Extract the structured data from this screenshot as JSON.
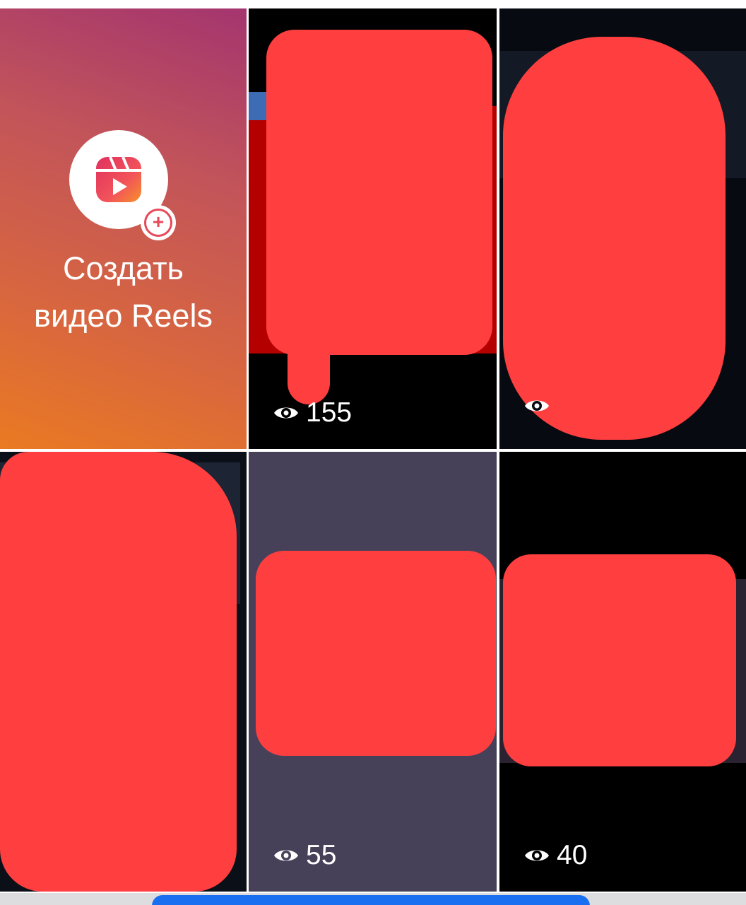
{
  "create_tile": {
    "label_line1": "Создать",
    "label_line2": "видео Reels",
    "icon": "reels-icon",
    "badge_icon": "plus-icon",
    "gradient_colors": [
      "#a4356f",
      "#c2545a",
      "#d8663f",
      "#ea7a22"
    ]
  },
  "reels": [
    {
      "views": "155",
      "icon": "eye-icon"
    },
    {
      "views": "",
      "icon": "eye-icon"
    },
    {
      "views": "",
      "icon": "eye-icon"
    },
    {
      "views": "55",
      "icon": "eye-icon"
    },
    {
      "views": "40",
      "icon": "eye-icon"
    }
  ],
  "colors": {
    "redaction": "#ff3f3f",
    "accent_blue": "#1a6ff0",
    "divider": "#ffffff"
  }
}
